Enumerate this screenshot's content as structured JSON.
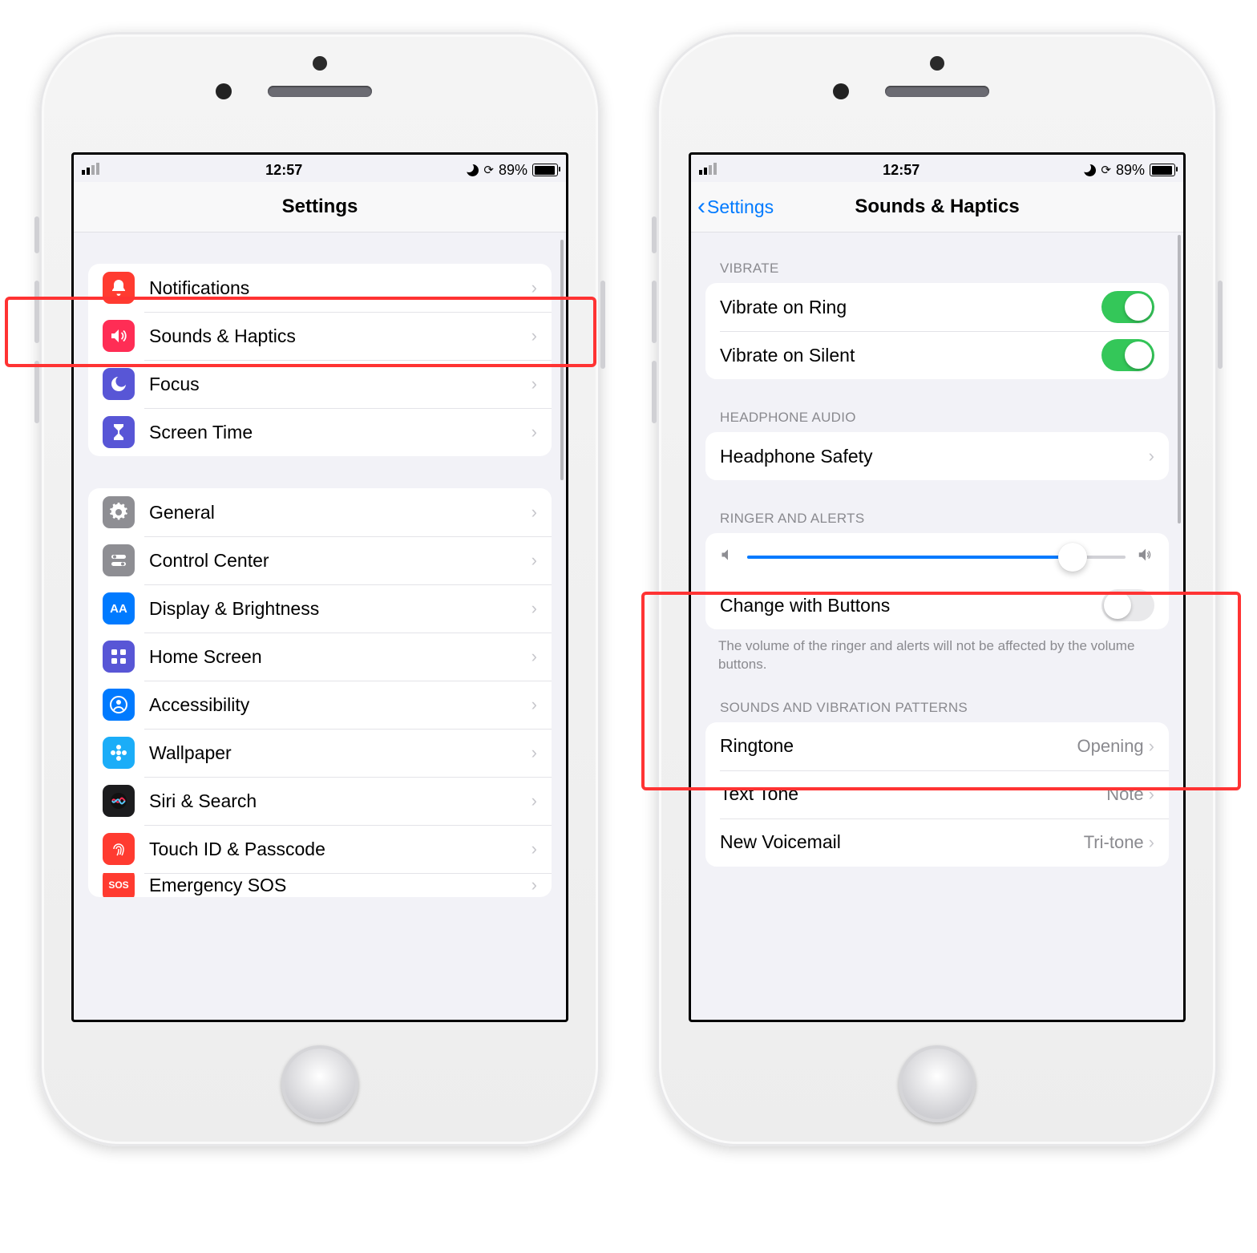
{
  "status": {
    "time": "12:57",
    "battery": "89%"
  },
  "left": {
    "title": "Settings",
    "groups": [
      {
        "rows": [
          {
            "key": "notifications",
            "label": "Notifications",
            "icon": "bell",
            "icon_bg": "bg-red"
          },
          {
            "key": "sounds",
            "label": "Sounds & Haptics",
            "icon": "speaker",
            "icon_bg": "bg-pink"
          },
          {
            "key": "focus",
            "label": "Focus",
            "icon": "moon",
            "icon_bg": "bg-indigo"
          },
          {
            "key": "screentime",
            "label": "Screen Time",
            "icon": "hourglass",
            "icon_bg": "bg-indigo"
          }
        ]
      },
      {
        "rows": [
          {
            "key": "general",
            "label": "General",
            "icon": "gear",
            "icon_bg": "bg-gray"
          },
          {
            "key": "controlcenter",
            "label": "Control Center",
            "icon": "switches",
            "icon_bg": "bg-gray"
          },
          {
            "key": "display",
            "label": "Display & Brightness",
            "icon": "AA",
            "icon_bg": "bg-blue",
            "text_icon": "AA"
          },
          {
            "key": "homescreen",
            "label": "Home Screen",
            "icon": "grid",
            "icon_bg": "bg-indigo"
          },
          {
            "key": "accessibility",
            "label": "Accessibility",
            "icon": "person",
            "icon_bg": "bg-blue"
          },
          {
            "key": "wallpaper",
            "label": "Wallpaper",
            "icon": "flower",
            "icon_bg": "bg-cyan"
          },
          {
            "key": "siri",
            "label": "Siri & Search",
            "icon": "siri",
            "icon_bg": "bg-dark"
          },
          {
            "key": "touchid",
            "label": "Touch ID & Passcode",
            "icon": "fingerprint",
            "icon_bg": "bg-touchid"
          },
          {
            "key": "sos",
            "label": "Emergency SOS",
            "icon": "sos",
            "icon_bg": "bg-sos",
            "text_icon": "SOS",
            "truncated": true
          }
        ]
      }
    ]
  },
  "right": {
    "back": "Settings",
    "title": "Sounds & Haptics",
    "sections": {
      "vibrate": {
        "header": "VIBRATE",
        "rows": [
          {
            "label": "Vibrate on Ring",
            "toggle": true
          },
          {
            "label": "Vibrate on Silent",
            "toggle": true
          }
        ]
      },
      "headphone": {
        "header": "HEADPHONE AUDIO",
        "rows": [
          {
            "label": "Headphone Safety",
            "chevron": true
          }
        ]
      },
      "ringer": {
        "header": "RINGER AND ALERTS",
        "slider_pct": 86,
        "cwb_label": "Change with Buttons",
        "cwb_toggle": false,
        "footer": "The volume of the ringer and alerts will not be affected by the volume buttons."
      },
      "patterns": {
        "header": "SOUNDS AND VIBRATION PATTERNS",
        "rows": [
          {
            "label": "Ringtone",
            "value": "Opening"
          },
          {
            "label": "Text Tone",
            "value": "Note"
          },
          {
            "label": "New Voicemail",
            "value": "Tri-tone"
          }
        ]
      }
    }
  }
}
